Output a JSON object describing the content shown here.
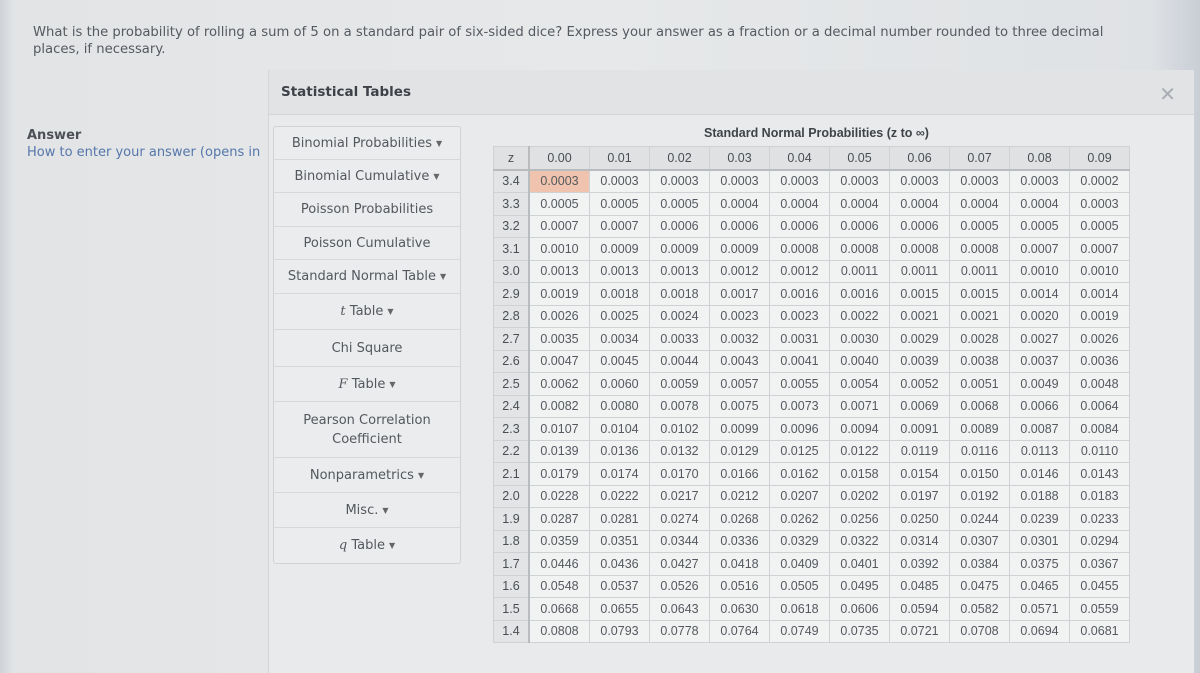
{
  "question": {
    "text": "What is the probability of rolling a sum of 5 on a standard pair of six-sided dice? Express your answer as a fraction or a decimal number rounded to three decimal places, if necessary."
  },
  "answer": {
    "label": "Answer",
    "help_link": "How to enter your answer (opens in"
  },
  "modal": {
    "title": "Statistical Tables",
    "close_icon": "close-x-icon",
    "menu": [
      {
        "label": "Binomial Probabilities",
        "prefix": "",
        "dropdown": true
      },
      {
        "label": "Binomial Cumulative",
        "prefix": "",
        "dropdown": true
      },
      {
        "label": "Poisson Probabilities",
        "prefix": "",
        "dropdown": false
      },
      {
        "label": "Poisson Cumulative",
        "prefix": "",
        "dropdown": false
      },
      {
        "label": "Standard Normal Table",
        "prefix": "",
        "dropdown": true
      },
      {
        "label": " Table",
        "prefix": "t",
        "dropdown": true
      },
      {
        "label": "Chi Square",
        "prefix": "",
        "dropdown": false
      },
      {
        "label": " Table",
        "prefix": "F",
        "dropdown": true
      },
      {
        "label": "Pearson Correlation",
        "label2": "Coefficient",
        "prefix": "",
        "dropdown": false
      },
      {
        "label": "Nonparametrics",
        "prefix": "",
        "dropdown": true
      },
      {
        "label": "Misc.",
        "prefix": "",
        "dropdown": true
      },
      {
        "label": " Table",
        "prefix": "q",
        "dropdown": true
      }
    ],
    "caret_glyph": "▼"
  },
  "table": {
    "title": "Standard Normal Probabilities (z to ∞)",
    "corner": "z",
    "columns": [
      "0.00",
      "0.01",
      "0.02",
      "0.03",
      "0.04",
      "0.05",
      "0.06",
      "0.07",
      "0.08",
      "0.09"
    ],
    "highlighted_cell": {
      "row": 0,
      "col": 0
    },
    "highlight_color": "#f0c3ae",
    "rows": [
      {
        "z": "3.4",
        "values": [
          "0.0003",
          "0.0003",
          "0.0003",
          "0.0003",
          "0.0003",
          "0.0003",
          "0.0003",
          "0.0003",
          "0.0003",
          "0.0002"
        ]
      },
      {
        "z": "3.3",
        "values": [
          "0.0005",
          "0.0005",
          "0.0005",
          "0.0004",
          "0.0004",
          "0.0004",
          "0.0004",
          "0.0004",
          "0.0004",
          "0.0003"
        ]
      },
      {
        "z": "3.2",
        "values": [
          "0.0007",
          "0.0007",
          "0.0006",
          "0.0006",
          "0.0006",
          "0.0006",
          "0.0006",
          "0.0005",
          "0.0005",
          "0.0005"
        ]
      },
      {
        "z": "3.1",
        "values": [
          "0.0010",
          "0.0009",
          "0.0009",
          "0.0009",
          "0.0008",
          "0.0008",
          "0.0008",
          "0.0008",
          "0.0007",
          "0.0007"
        ]
      },
      {
        "z": "3.0",
        "values": [
          "0.0013",
          "0.0013",
          "0.0013",
          "0.0012",
          "0.0012",
          "0.0011",
          "0.0011",
          "0.0011",
          "0.0010",
          "0.0010"
        ]
      },
      {
        "z": "2.9",
        "values": [
          "0.0019",
          "0.0018",
          "0.0018",
          "0.0017",
          "0.0016",
          "0.0016",
          "0.0015",
          "0.0015",
          "0.0014",
          "0.0014"
        ]
      },
      {
        "z": "2.8",
        "values": [
          "0.0026",
          "0.0025",
          "0.0024",
          "0.0023",
          "0.0023",
          "0.0022",
          "0.0021",
          "0.0021",
          "0.0020",
          "0.0019"
        ]
      },
      {
        "z": "2.7",
        "values": [
          "0.0035",
          "0.0034",
          "0.0033",
          "0.0032",
          "0.0031",
          "0.0030",
          "0.0029",
          "0.0028",
          "0.0027",
          "0.0026"
        ]
      },
      {
        "z": "2.6",
        "values": [
          "0.0047",
          "0.0045",
          "0.0044",
          "0.0043",
          "0.0041",
          "0.0040",
          "0.0039",
          "0.0038",
          "0.0037",
          "0.0036"
        ]
      },
      {
        "z": "2.5",
        "values": [
          "0.0062",
          "0.0060",
          "0.0059",
          "0.0057",
          "0.0055",
          "0.0054",
          "0.0052",
          "0.0051",
          "0.0049",
          "0.0048"
        ]
      },
      {
        "z": "2.4",
        "values": [
          "0.0082",
          "0.0080",
          "0.0078",
          "0.0075",
          "0.0073",
          "0.0071",
          "0.0069",
          "0.0068",
          "0.0066",
          "0.0064"
        ]
      },
      {
        "z": "2.3",
        "values": [
          "0.0107",
          "0.0104",
          "0.0102",
          "0.0099",
          "0.0096",
          "0.0094",
          "0.0091",
          "0.0089",
          "0.0087",
          "0.0084"
        ]
      },
      {
        "z": "2.2",
        "values": [
          "0.0139",
          "0.0136",
          "0.0132",
          "0.0129",
          "0.0125",
          "0.0122",
          "0.0119",
          "0.0116",
          "0.0113",
          "0.0110"
        ]
      },
      {
        "z": "2.1",
        "values": [
          "0.0179",
          "0.0174",
          "0.0170",
          "0.0166",
          "0.0162",
          "0.0158",
          "0.0154",
          "0.0150",
          "0.0146",
          "0.0143"
        ]
      },
      {
        "z": "2.0",
        "values": [
          "0.0228",
          "0.0222",
          "0.0217",
          "0.0212",
          "0.0207",
          "0.0202",
          "0.0197",
          "0.0192",
          "0.0188",
          "0.0183"
        ]
      },
      {
        "z": "1.9",
        "values": [
          "0.0287",
          "0.0281",
          "0.0274",
          "0.0268",
          "0.0262",
          "0.0256",
          "0.0250",
          "0.0244",
          "0.0239",
          "0.0233"
        ]
      },
      {
        "z": "1.8",
        "values": [
          "0.0359",
          "0.0351",
          "0.0344",
          "0.0336",
          "0.0329",
          "0.0322",
          "0.0314",
          "0.0307",
          "0.0301",
          "0.0294"
        ]
      },
      {
        "z": "1.7",
        "values": [
          "0.0446",
          "0.0436",
          "0.0427",
          "0.0418",
          "0.0409",
          "0.0401",
          "0.0392",
          "0.0384",
          "0.0375",
          "0.0367"
        ]
      },
      {
        "z": "1.6",
        "values": [
          "0.0548",
          "0.0537",
          "0.0526",
          "0.0516",
          "0.0505",
          "0.0495",
          "0.0485",
          "0.0475",
          "0.0465",
          "0.0455"
        ]
      },
      {
        "z": "1.5",
        "values": [
          "0.0668",
          "0.0655",
          "0.0643",
          "0.0630",
          "0.0618",
          "0.0606",
          "0.0594",
          "0.0582",
          "0.0571",
          "0.0559"
        ]
      },
      {
        "z": "1.4",
        "values": [
          "0.0808",
          "0.0793",
          "0.0778",
          "0.0764",
          "0.0749",
          "0.0735",
          "0.0721",
          "0.0708",
          "0.0694",
          "0.0681"
        ]
      }
    ]
  }
}
